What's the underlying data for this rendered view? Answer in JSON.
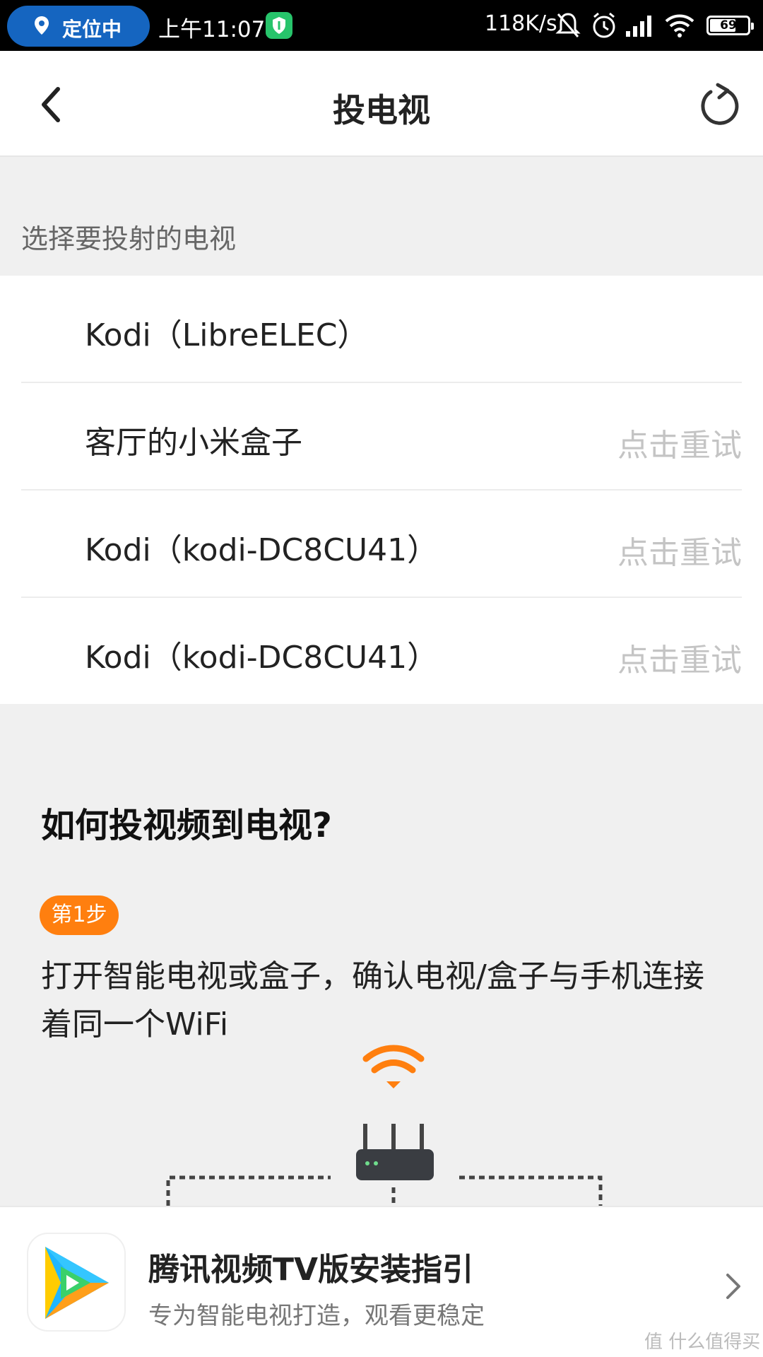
{
  "status_bar": {
    "location": "定位中",
    "time": "上午11:07",
    "net_speed": "118K/s",
    "battery": "69",
    "icons": [
      "location-pin-icon",
      "shield-icon",
      "silent-bell-icon",
      "alarm-icon",
      "signal-icon",
      "wifi-icon",
      "battery-icon"
    ]
  },
  "header": {
    "title": "投电视",
    "back_icon": "chevron-left-icon",
    "refresh_icon": "refresh-icon"
  },
  "section_label": "选择要投射的电视",
  "devices": [
    {
      "name": "Kodi（LibreELEC）",
      "action": ""
    },
    {
      "name": "客厅的小米盒子",
      "action": "点击重试"
    },
    {
      "name": "Kodi（kodi-DC8CU41）",
      "action": "点击重试"
    },
    {
      "name": "Kodi（kodi-DC8CU41）",
      "action": "点击重试"
    }
  ],
  "howto": {
    "title": "如何投视频到电视?",
    "step_badge": "第1步",
    "step_text": "打开智能电视或盒子，确认电视/盒子与手机连接着同一个WiFi"
  },
  "banner": {
    "title": "腾讯视频TV版安装指引",
    "subtitle": "专为智能电视打造，观看更稳定",
    "chevron_icon": "chevron-right-icon"
  },
  "watermark": "值 什么值得买",
  "colors": {
    "accent_orange": "#ff7f0f",
    "location_pill": "#1565c0",
    "shield_green": "#27c46b",
    "retry_gray": "#c4c4c4"
  }
}
